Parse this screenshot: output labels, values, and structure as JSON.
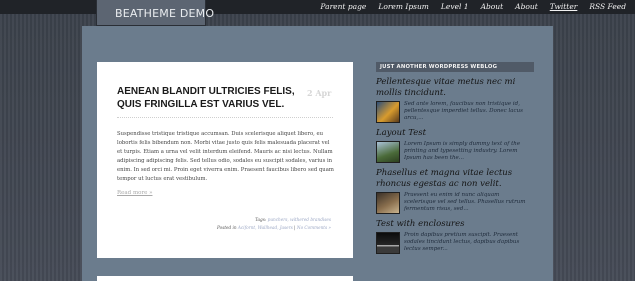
{
  "header": {
    "logo": "BEATHEME DEMO",
    "nav": [
      {
        "label": "Parent page",
        "active": false
      },
      {
        "label": "Lorem Ipsum",
        "active": false
      },
      {
        "label": "Level 1",
        "active": false
      },
      {
        "label": "About",
        "active": false
      },
      {
        "label": "About",
        "active": false
      },
      {
        "label": "Twitter",
        "active": true
      },
      {
        "label": "RSS Feed",
        "active": false
      }
    ]
  },
  "post": {
    "title": "AENEAN BLANDIT ULTRICIES FELIS, QUIS FRINGILLA EST VARIUS VEL.",
    "date": "2 Apr",
    "body": "Suspendisse tristique tristique accumsan. Duis scelerisque aliquet libero, eu lobortis felis bibendum non. Morbi vitae justo quis felis malesuada placerat vel et turpis. Etiam a urna vel velit interdum eleifend. Mauris ac nisi lectus. Nullam adipiscing adipiscing felis. Sed tellus odio, sodales eu suscipit sodales, varius in enim. In sed orci mi. Proin eget viverra enim. Praesent faucibus libero sed quam tempor ut luctus erat vestibulum.",
    "read_more": "Read more »",
    "tags_label": "Tags:",
    "tags": "punchers, withered brandises",
    "posted_label": "Posted in",
    "categories": "Acifornt, Wallhead, Jasers",
    "comments": "No Comments »"
  },
  "sidebar": {
    "widget_title": "JUST ANOTHER WORDPRESS WEBLOG",
    "entries": [
      {
        "title": "Pellentesque vitae metus nec mi mollis tincidunt.",
        "excerpt": "Sed ante lorem, faucibus non tristique id, pellentesque imperdiet tellus. Donec lacus arcu,..."
      },
      {
        "title": "Layout Test",
        "excerpt": "Lorem Ipsum is simply dummy text of the printing and typesetting industry. Lorem Ipsum has been the..."
      },
      {
        "title": "Phasellus et magna vitae lectus rhoncus egestas ac non velit.",
        "excerpt": "Praesent eu enim id nunc aliquam scelerisque vel sed tellus. Phasellus rutrum fermentum risus, sed..."
      },
      {
        "title": "Test with enclosures",
        "excerpt": "Proin dapibus pretium suscipit. Praesent sodales tincidunt lectus, dapibus dapibus lectus semper..."
      }
    ]
  }
}
